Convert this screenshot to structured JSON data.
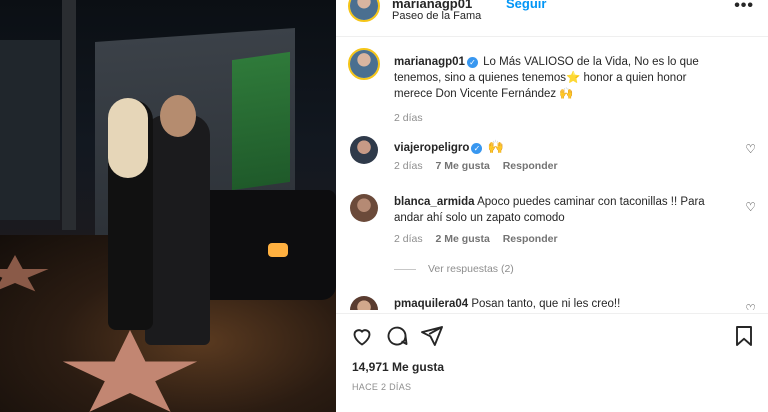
{
  "post": {
    "username": "marianagp01",
    "follow_label": "Seguir",
    "location": "Paseo de la Fama",
    "more_label": "•••"
  },
  "caption": {
    "username": "marianagp01",
    "text": "Lo Más VALIOSO de la Vida, No es lo que tenemos, sino a quienes tenemos⭐ honor a quien honor merece Don Vicente Fernández 🙌",
    "time": "2 días"
  },
  "comments": [
    {
      "username": "viajeropeligro",
      "text": "🙌",
      "time": "2 días",
      "likes": "7 Me gusta",
      "reply": "Responder"
    },
    {
      "username": "blanca_armida",
      "text": "Apoco puedes caminar con taconillas !! Para andar ahí solo un zapato comodo",
      "time": "2 días",
      "likes": "2 Me gusta",
      "reply": "Responder"
    },
    {
      "username": "pmaquilera04",
      "text": "Posan tanto, que ni les creo!!"
    }
  ],
  "view_replies": "Ver respuestas (2)",
  "footer": {
    "likes": "14,971 Me gusta",
    "time_ago": "HACE 2 DÍAS"
  },
  "colors": {
    "link": "#0095f6",
    "verified": "#3897f0",
    "muted": "#8e8e8e"
  },
  "icons": [
    "heart-icon",
    "comment-icon",
    "share-icon",
    "bookmark-icon",
    "verified-icon",
    "more-icon"
  ]
}
